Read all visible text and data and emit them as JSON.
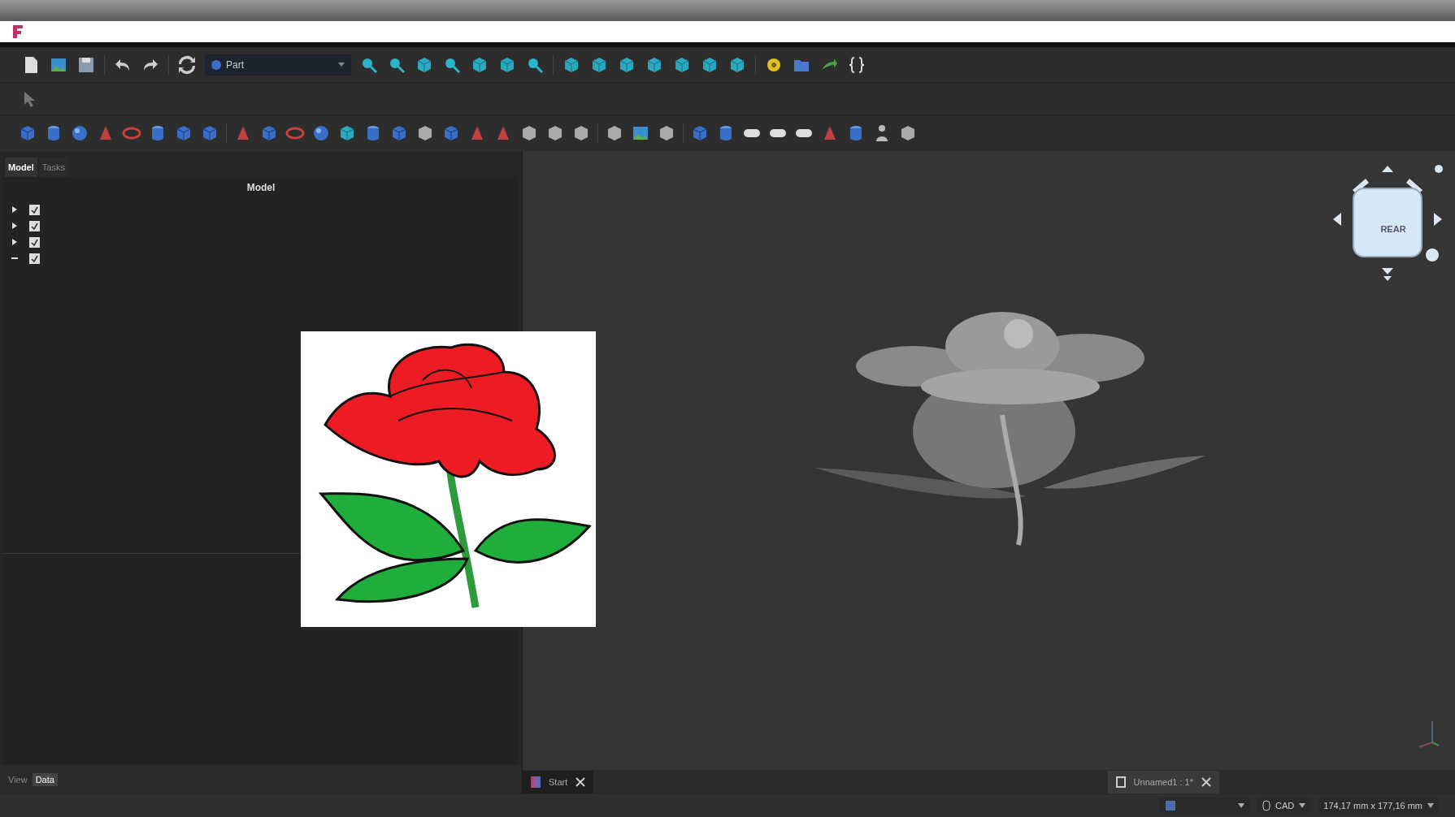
{
  "toolbar": {
    "workbench": "Part"
  },
  "combo_view": {
    "tabs": [
      {
        "label": "Model",
        "selected": true
      },
      {
        "label": "Tasks",
        "selected": false
      }
    ],
    "panel_title": "Model",
    "tree": [
      {
        "expanded": false,
        "checked": true
      },
      {
        "expanded": false,
        "checked": true
      },
      {
        "expanded": false,
        "checked": true
      },
      {
        "expanded": true,
        "checked": true
      }
    ],
    "property_tabs": [
      {
        "label": "View",
        "selected": false
      },
      {
        "label": "Data",
        "selected": true
      }
    ]
  },
  "nav_cube": {
    "face": "REAR"
  },
  "document_tabs": [
    {
      "label": "Start",
      "selected": false
    },
    {
      "label": "Unnamed1 : 1*",
      "selected": true
    }
  ],
  "status_bar": {
    "navigation": "CAD",
    "dimensions": "174,17 mm x 177,16 mm"
  }
}
